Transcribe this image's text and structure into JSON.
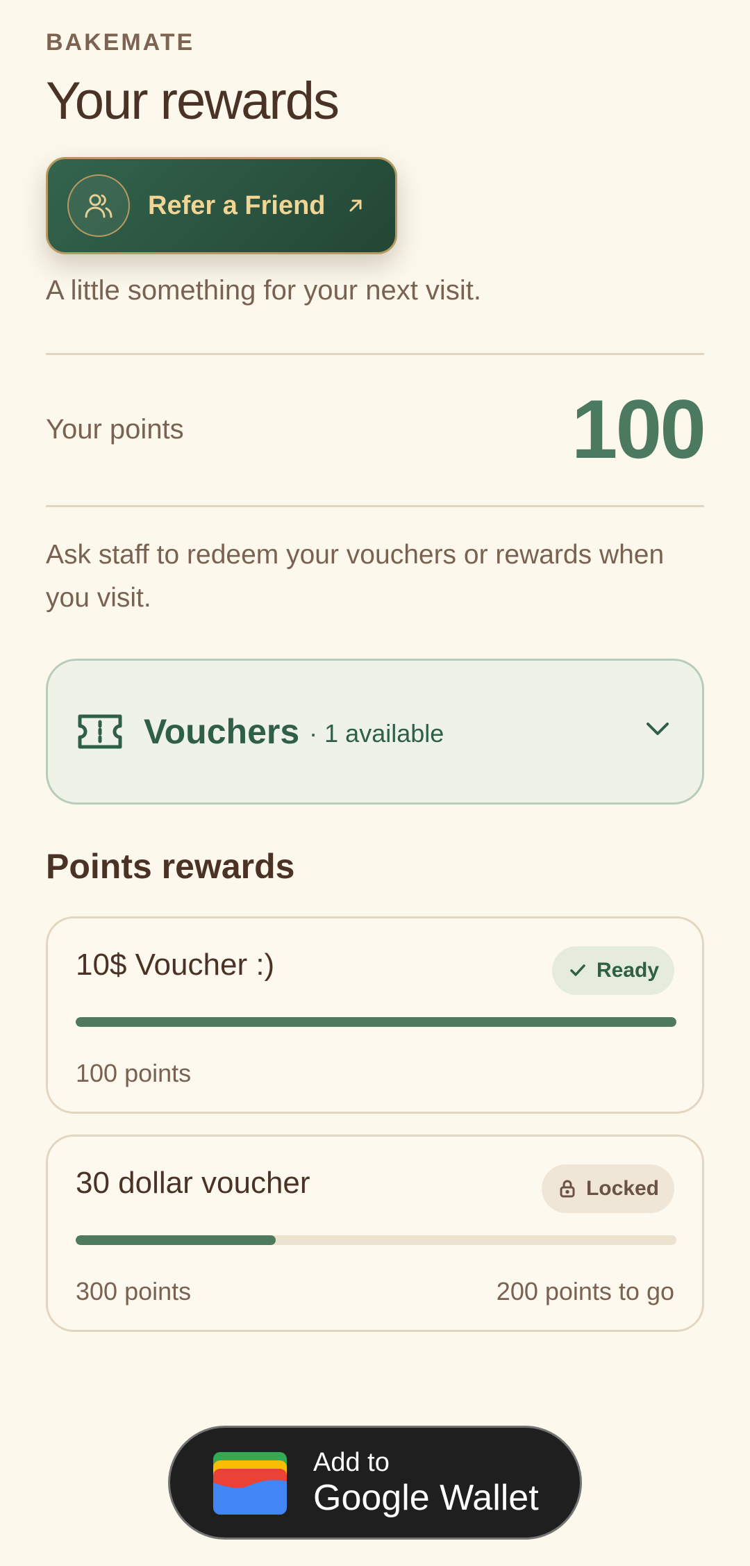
{
  "header": {
    "brand": "BAKEMATE",
    "title": "Your rewards",
    "subtitle": "A little something for your next visit."
  },
  "refer": {
    "label": "Refer a Friend",
    "icon": "people-icon",
    "arrow_icon": "arrow-up-right-icon"
  },
  "points": {
    "label": "Your points",
    "value": "100"
  },
  "instructions": "Ask staff to redeem your vouchers or rewards when you visit.",
  "vouchers": {
    "icon": "ticket-icon",
    "label": "Vouchers",
    "count": "· 1 available",
    "chevron_icon": "chevron-down-icon"
  },
  "points_rewards": {
    "heading": "Points rewards",
    "items": [
      {
        "name": "10$ Voucher :)",
        "status": "Ready",
        "status_icon": "check-icon",
        "points": "100 points",
        "to_go": "",
        "progress": 1.0
      },
      {
        "name": "30 dollar voucher",
        "status": "Locked",
        "status_icon": "lock-icon",
        "points": "300 points",
        "to_go": "200 points to go",
        "progress": 0.333
      }
    ]
  },
  "wallet": {
    "line1": "Add to",
    "line2": "Google Wallet",
    "icon": "google-wallet-icon"
  },
  "colors": {
    "background": "#fcf8ec",
    "accent_green": "#4b7a60",
    "dark_green": "#234635",
    "gold": "#f0d594",
    "brown_text": "#4a3226"
  }
}
